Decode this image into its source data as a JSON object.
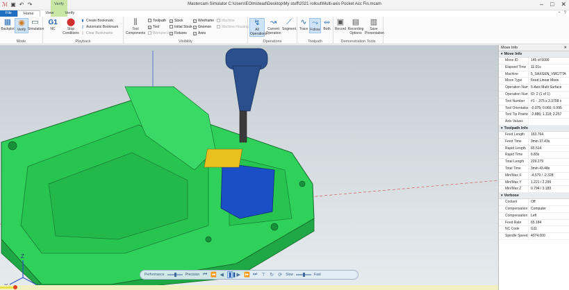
{
  "window": {
    "title": "Mastercam Simulator  C:\\Users\\EOlmstead\\Desktop\\My stuff\\2021 rollout\\Multi-axis Pocket Acc Fin.mcam",
    "context_tab": "Verify",
    "controls": {
      "minimize": "–",
      "maximize": "□",
      "close": "✕"
    }
  },
  "tabs": [
    "File",
    "Home",
    "View",
    "Verify"
  ],
  "ribbon": {
    "mode": {
      "label": "Mode",
      "backplot": "Backplot",
      "verify": "Verify",
      "simulation": "Simulation"
    },
    "playback": {
      "label": "Playback",
      "g1": "G1",
      "nc": "NC",
      "stop_conditions": "Stop Conditions",
      "create_bookmark": "Create Bookmark",
      "automatic_bookmark": "Automatic Bookmark",
      "clear_bookmarks": "Clear Bookmarks"
    },
    "visibility": {
      "label": "Visibility",
      "tool_components": "Tool Components",
      "toolpath": "Toolpath",
      "tool": "Tool",
      "workpiece": "Workpiece",
      "stock": "Stock",
      "initial_stock": "Initial Stock",
      "fixtures": "Fixtures",
      "wireframe": "Wireframe",
      "gnomon": "Gnomon",
      "axes": "Axes",
      "machine": "Machine",
      "machine_housing": "Machine Housing"
    },
    "operations": {
      "label": "Operations",
      "all": "All Operations",
      "current": "Current Operation",
      "segment": "Segment"
    },
    "toolpath": {
      "label": "Toolpath",
      "trace": "Trace",
      "follow": "Follow",
      "both": "Both"
    },
    "demonstration": {
      "label": "Demonstration Tools",
      "record": "Record",
      "recording_options": "Recording Options",
      "save_presentation": "Save Presentation"
    }
  },
  "playbar": {
    "performance": "Performance",
    "precision": "Precision",
    "slow": "Slow",
    "fast": "Fast"
  },
  "gnomon": {
    "x": "X",
    "y": "Y",
    "z": "Z"
  },
  "move_info": {
    "title": "Move Info",
    "sections": [
      {
        "name": "Move Info",
        "rows": [
          {
            "k": "Move ID",
            "v": "145 of 5000"
          },
          {
            "k": "Elapsed Time",
            "v": "11.01s"
          },
          {
            "k": "Machine",
            "v": "5_SAXGEN_VMC/TTA"
          },
          {
            "k": "Move Type",
            "v": "Feed Linear Move"
          },
          {
            "k": "Operation Name",
            "v": "5-Axis Multi Surface"
          },
          {
            "k": "Operation Numb",
            "v": "ID: 2 (1 of 1)"
          },
          {
            "k": "Tool Number",
            "v": "#1 - .375 x 3.3758 x"
          },
          {
            "k": "Tool Orientation",
            "v": "-0.075; 0.066; 0.995"
          },
          {
            "k": "Tool Tip Position",
            "v": "-2.886; 1.118; 2.257"
          },
          {
            "k": "Axis Values",
            "v": ""
          }
        ]
      },
      {
        "name": "Toolpath Info",
        "rows": [
          {
            "k": "Feed Length",
            "v": "163.764"
          },
          {
            "k": "Feed Time",
            "v": "3min 37.43s"
          },
          {
            "k": "Rapid Length",
            "v": "65.514"
          },
          {
            "k": "Rapid Time",
            "v": "6.83s"
          },
          {
            "k": "Total Length",
            "v": "229.279"
          },
          {
            "k": "Total Time",
            "v": "3min 43.48s"
          },
          {
            "k": "Min/Max X",
            "v": "-4.579 / -2.328"
          },
          {
            "k": "Min/Max Y",
            "v": "1.221 / 2.299"
          },
          {
            "k": "Min/Max Z",
            "v": "0.794 / 3.183"
          }
        ]
      },
      {
        "name": "Verbose",
        "rows": [
          {
            "k": "Coolant",
            "v": "Off"
          },
          {
            "k": "Compensation T",
            "v": "Computer"
          },
          {
            "k": "Compensation D",
            "v": "Left"
          },
          {
            "k": "Feed Rate",
            "v": "65.184"
          },
          {
            "k": "NC Code",
            "v": "G11"
          },
          {
            "k": "Spindle Speed",
            "v": "4074.000"
          }
        ]
      }
    ]
  },
  "playback_progress": 0.03,
  "colors": {
    "part": "#2fd15a",
    "tool_holder": "#2a4f8c",
    "tool_tip": "#e8c020",
    "pocket": "#1a4fc8",
    "accent": "#1f6fc0"
  }
}
